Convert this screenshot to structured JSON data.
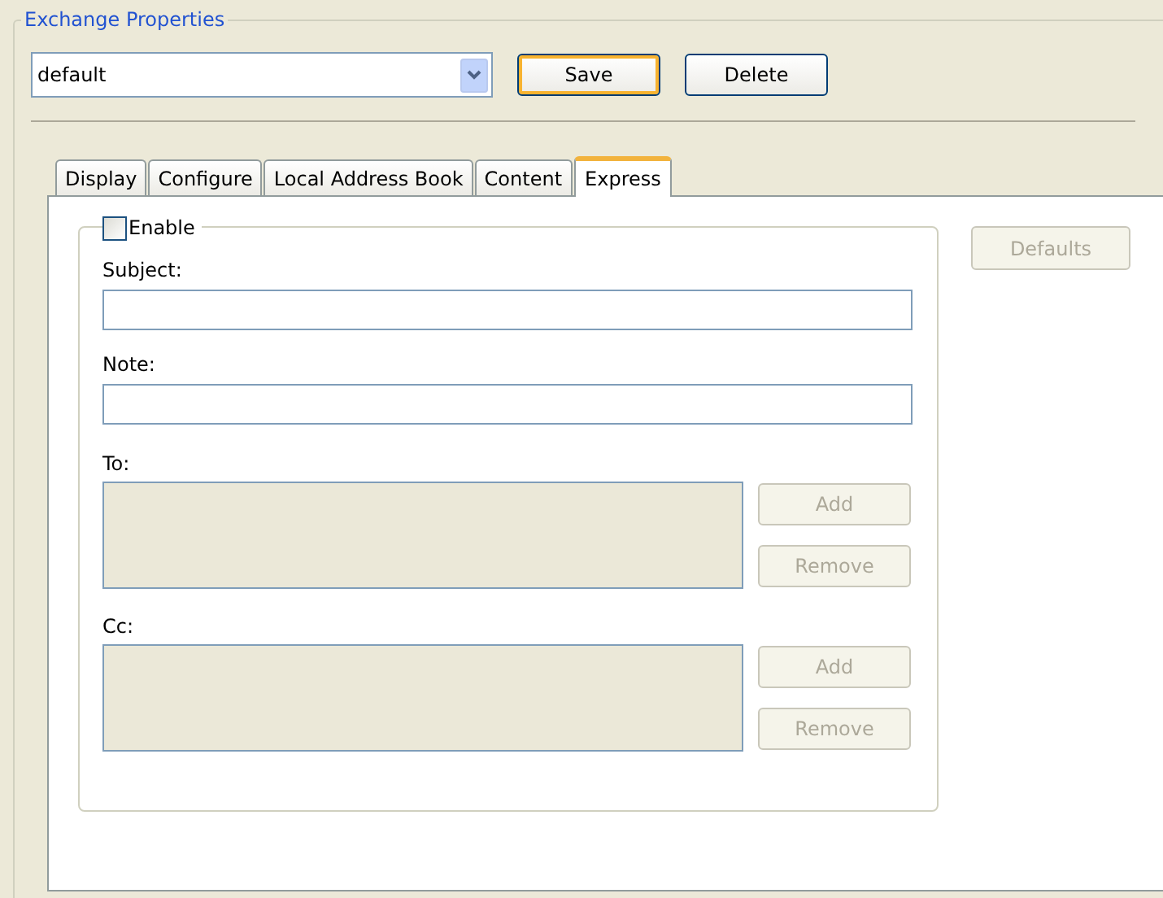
{
  "group_title": "Exchange Properties",
  "profile": {
    "value": "default"
  },
  "buttons": [
    {
      "label": "Save",
      "focused": true
    },
    {
      "label": "Delete",
      "focused": false
    }
  ],
  "tabs": [
    {
      "label": "Display",
      "selected": false
    },
    {
      "label": "Configure",
      "selected": false
    },
    {
      "label": "Local Address Book",
      "selected": false
    },
    {
      "label": "Content",
      "selected": false
    },
    {
      "label": "Express",
      "selected": true
    }
  ],
  "express": {
    "enable": {
      "label": "Enable",
      "checked": false
    },
    "defaults_button": {
      "label": "Defaults",
      "disabled": true
    },
    "fields": [
      {
        "label": "Subject:"
      },
      {
        "label": "Note:"
      }
    ],
    "lists": [
      {
        "label": "To:",
        "buttons": [
          {
            "label": "Add",
            "disabled": true
          },
          {
            "label": "Remove",
            "disabled": true
          }
        ]
      },
      {
        "label": "Cc:",
        "buttons": [
          {
            "label": "Add",
            "disabled": true
          },
          {
            "label": "Remove",
            "disabled": true
          }
        ]
      }
    ]
  }
}
